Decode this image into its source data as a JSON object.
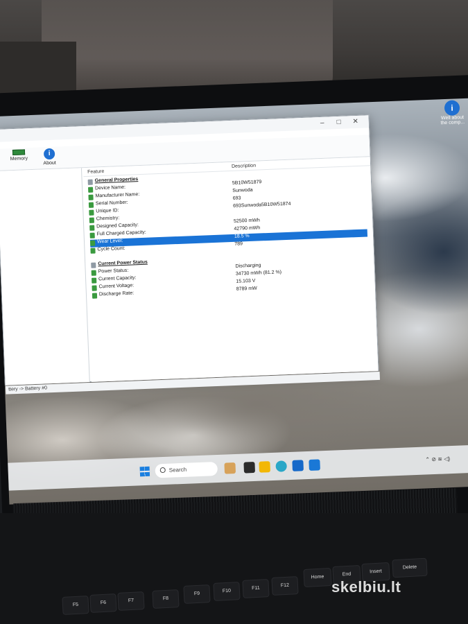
{
  "toolbar": {
    "memory_label": "Memory",
    "about_label": "About"
  },
  "columns": {
    "feature": "Feature",
    "description": "Description"
  },
  "general": {
    "title": "General Properties",
    "rows": [
      {
        "label": "Device Name:",
        "value": "5B10W51879"
      },
      {
        "label": "Manufacturer Name:",
        "value": "Sunwoda"
      },
      {
        "label": "Serial Number:",
        "value": "693"
      },
      {
        "label": "Unique ID:",
        "value": "693Sunwoda5B10W51874"
      },
      {
        "label": "Chemistry:",
        "value": ""
      },
      {
        "label": "Designed Capacity:",
        "value": "52500 mWh"
      },
      {
        "label": "Full Charged Capacity:",
        "value": "42790 mWh"
      },
      {
        "label": "Wear Level:",
        "value": "18.5 %"
      },
      {
        "label": "Cycle Count:",
        "value": "789"
      }
    ]
  },
  "power": {
    "title": "Current Power Status",
    "rows": [
      {
        "label": "Power Status:",
        "value": "Discharging"
      },
      {
        "label": "Current Capacity:",
        "value": "34730 mWh (81.2 %)"
      },
      {
        "label": "Current Voltage:",
        "value": "15.103 V"
      },
      {
        "label": "Discharge Rate:",
        "value": "8789 mW"
      }
    ]
  },
  "statusbar": "ttery -> Battery #0",
  "desktop_icon": "Well about the comp...",
  "taskbar": {
    "search_placeholder": "Search"
  },
  "keyboard": {
    "keys": [
      "F5",
      "F6",
      "F7",
      "F8",
      "F9",
      "F10",
      "F11",
      "F12",
      "Home",
      "End",
      "Insert",
      "Delete"
    ]
  },
  "watermark": "skelbiu.lt"
}
